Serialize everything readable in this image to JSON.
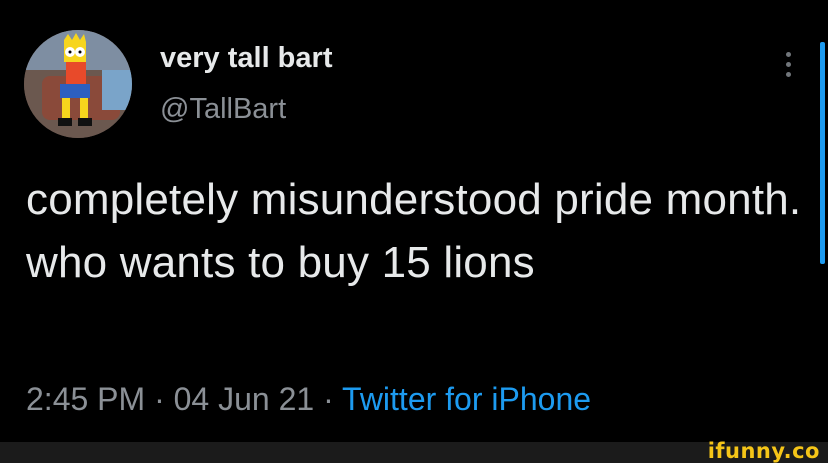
{
  "tweet": {
    "display_name": "very tall bart",
    "handle": "@TallBart",
    "text": "completely misunderstood pride month. who wants to buy 15 lions",
    "time": "2:45 PM",
    "separator1": " · ",
    "date": "04 Jun 21",
    "separator2": " · ",
    "source": "Twitter for iPhone"
  },
  "icons": {
    "more": "more-vertical-icon",
    "avatar": "avatar-bart-icon"
  },
  "watermark": {
    "text": "ifunny.co"
  },
  "colors": {
    "background": "#000000",
    "primary_text": "#e7e9ea",
    "secondary_text": "#8b9096",
    "link": "#1d9bf0",
    "watermark": "#f5c518"
  }
}
